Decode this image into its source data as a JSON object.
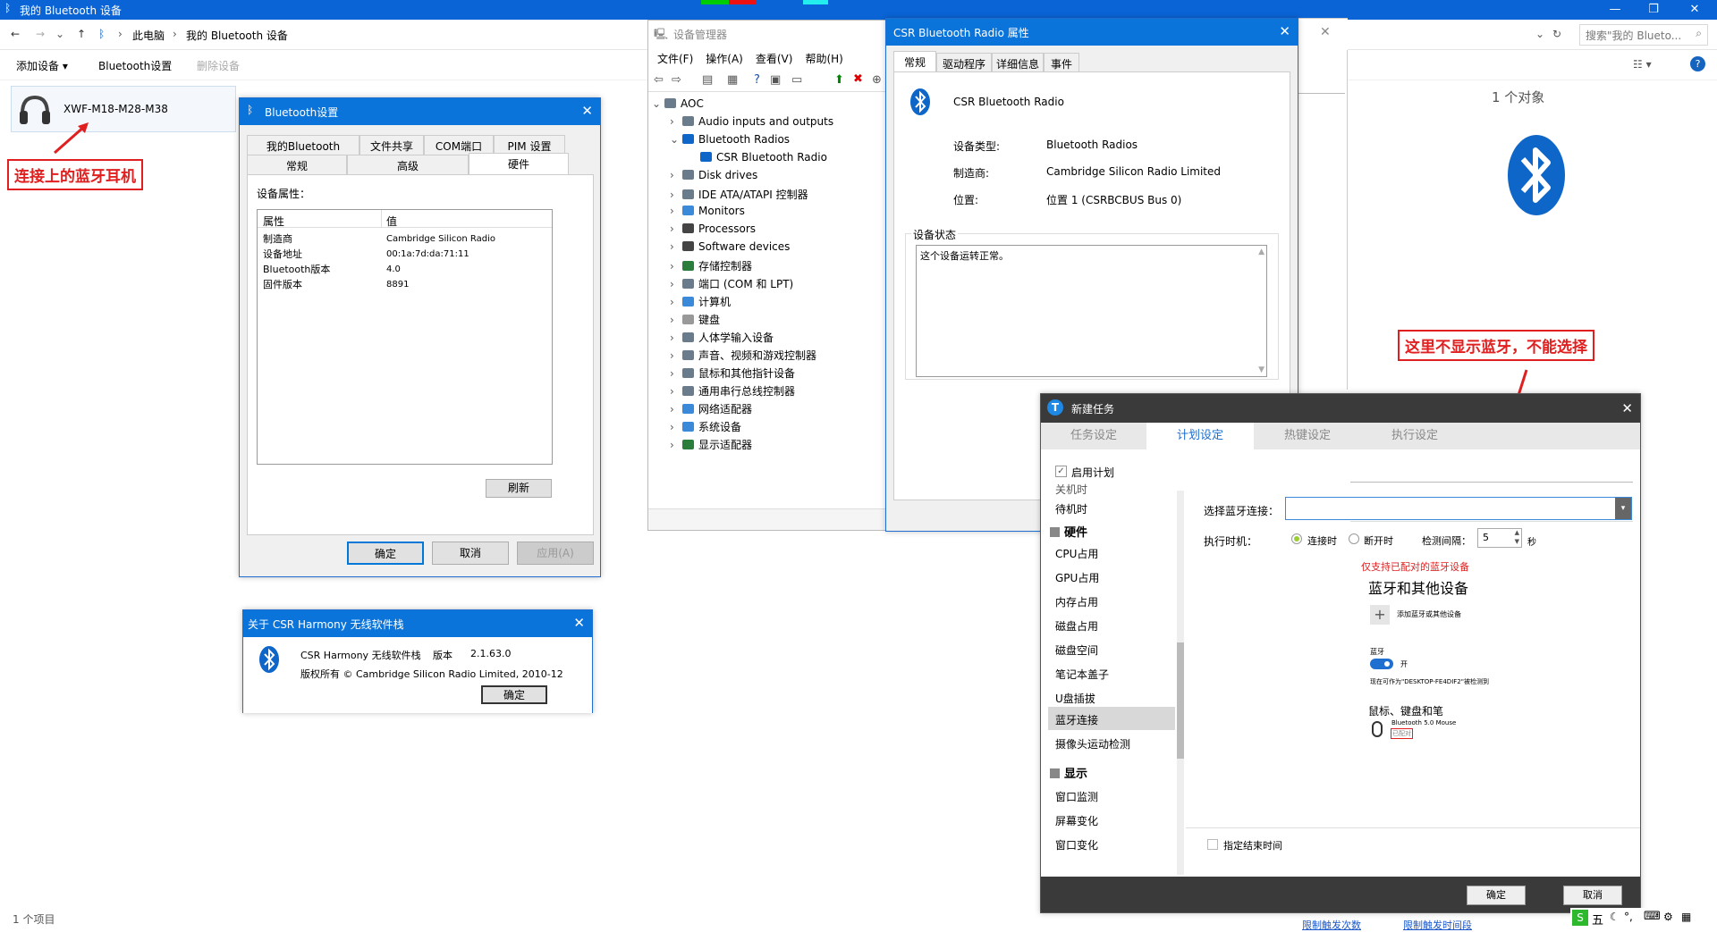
{
  "explorer": {
    "title": "我的 Bluetooth 设备",
    "crumbs": [
      "此电脑",
      "我的 Bluetooth 设备"
    ],
    "search_placeholder": "搜索\"我的 Blueto...",
    "cmd": {
      "add": "添加设备",
      "settings": "Bluetooth设置",
      "remove": "删除设备"
    },
    "device_name": "XWF-M18-M28-M38",
    "count": "1 个对象",
    "status": "1 个项目"
  },
  "callouts": {
    "left": "连接上的蓝牙耳机",
    "right": "这里不显示蓝牙，不能选择"
  },
  "bt_settings": {
    "title": "Bluetooth设置",
    "tabs_top": [
      "我的Bluetooth Services",
      "文件共享",
      "COM端口",
      "PIM 设置"
    ],
    "tabs_bottom": [
      "常规",
      "高级",
      "硬件"
    ],
    "section": "设备属性：",
    "col_prop": "属性",
    "col_val": "值",
    "rows": [
      [
        "制造商",
        "Cambridge Silicon Radio"
      ],
      [
        "设备地址",
        "00:1a:7d:da:71:11"
      ],
      [
        "Bluetooth版本",
        "4.0"
      ],
      [
        "固件版本",
        "8891"
      ]
    ],
    "refresh": "刷新",
    "ok": "确定",
    "cancel": "取消",
    "apply": "应用(A)"
  },
  "about": {
    "title": "关于 CSR Harmony 无线软件栈",
    "line1": "CSR Harmony 无线软件栈",
    "ver_label": "版本",
    "version": "2.1.63.0",
    "line2": "版权所有 © Cambridge Silicon Radio Limited, 2010-12",
    "ok": "确定"
  },
  "devmgr": {
    "title": "设备管理器",
    "menu": [
      "文件(F)",
      "操作(A)",
      "查看(V)",
      "帮助(H)"
    ],
    "items": [
      "AOC",
      "Audio inputs and outputs",
      "Bluetooth Radios",
      "CSR Bluetooth Radio",
      "Disk drives",
      "IDE ATA/ATAPI 控制器",
      "Monitors",
      "Processors",
      "Software devices",
      "存储控制器",
      "端口 (COM 和 LPT)",
      "计算机",
      "键盘",
      "人体学输入设备",
      "声音、视频和游戏控制器",
      "鼠标和其他指针设备",
      "通用串行总线控制器",
      "网络适配器",
      "系统设备",
      "显示适配器"
    ]
  },
  "csr_props": {
    "title": "CSR Bluetooth Radio 属性",
    "tabs": [
      "常规",
      "驱动程序",
      "详细信息",
      "事件"
    ],
    "name": "CSR Bluetooth Radio",
    "type_label": "设备类型:",
    "type": "Bluetooth Radios",
    "mfr_label": "制造商:",
    "mfr": "Cambridge Silicon Radio Limited",
    "loc_label": "位置:",
    "loc": "位置 1 (CSRBCBUS Bus 0)",
    "status_group": "设备状态",
    "status": "这个设备运转正常。"
  },
  "newtask": {
    "title": "新建任务",
    "tabs": [
      "任务设定",
      "计划设定",
      "热键设定",
      "执行设定"
    ],
    "enable": "启用计划",
    "nav_top": [
      "关机时",
      "待机时"
    ],
    "sec_hw": "硬件",
    "hw_items": [
      "CPU占用",
      "GPU占用",
      "内存占用",
      "磁盘占用",
      "磁盘空间",
      "笔记本盖子",
      "U盘插拔",
      "蓝牙连接",
      "摄像头运动检测"
    ],
    "sec_disp": "显示",
    "disp_items": [
      "窗口监测",
      "屏幕变化",
      "窗口变化"
    ],
    "select_label": "选择蓝牙连接：",
    "exec_label": "执行时机：",
    "on_connect": "连接时",
    "on_disconnect": "断开时",
    "interval_label": "检测间隔：",
    "interval": "5",
    "sec_unit": "秒",
    "note": "仅支持已配对的蓝牙设备",
    "help_title": "蓝牙和其他设备",
    "add_text": "添加蓝牙或其他设备",
    "bt_label": "蓝牙",
    "bt_on": "开",
    "discover": "现在可作为\"DESKTOP-FE4DIF2\"被检测到",
    "mice": "鼠标、键盘和笔",
    "mouse_name": "Bluetooth 5.0 Mouse",
    "paired": "已配对",
    "end_time": "指定结束时间",
    "link1": "限制触发次数",
    "link2": "限制触发时间段",
    "ok": "确定",
    "cancel": "取消"
  },
  "tray": {
    "ime": "五"
  }
}
